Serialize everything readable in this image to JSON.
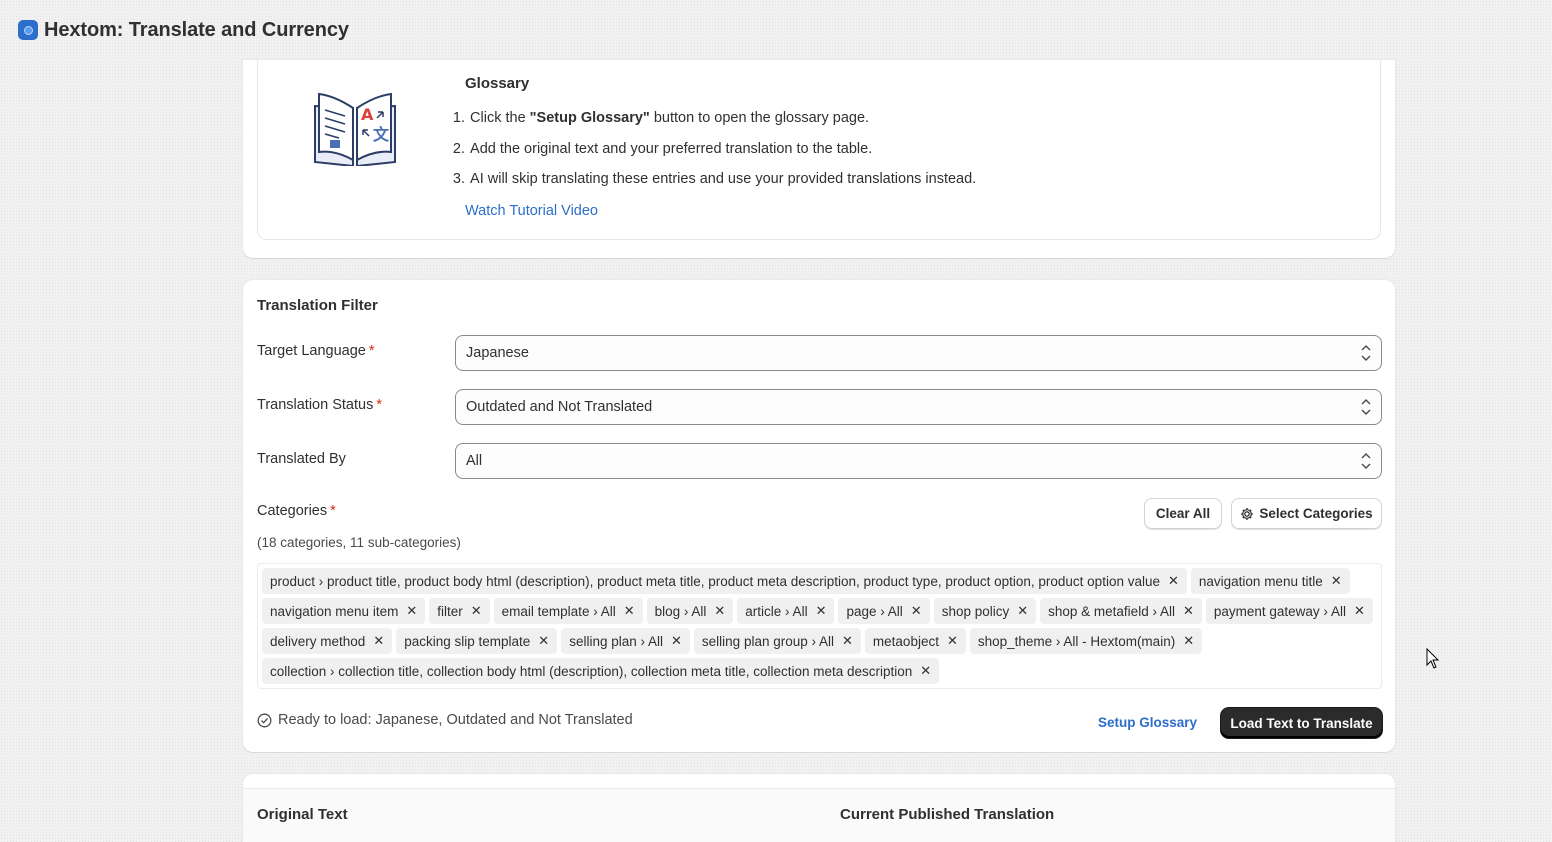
{
  "app": {
    "title": "Hextom: Translate and Currency"
  },
  "glossary": {
    "title": "Glossary",
    "steps": [
      {
        "num": "1.",
        "before": "Click the ",
        "bold": "\"Setup Glossary\"",
        "after": " button to open the glossary page."
      },
      {
        "num": "2.",
        "before": "Add the original text and your preferred translation to the table.",
        "bold": "",
        "after": ""
      },
      {
        "num": "3.",
        "before": "AI will skip translating these entries and use your provided translations instead.",
        "bold": "",
        "after": ""
      }
    ],
    "link": "Watch Tutorial Video"
  },
  "filter": {
    "title": "Translation Filter",
    "target_language": {
      "label": "Target Language",
      "required": "*",
      "value": "Japanese"
    },
    "translation_status": {
      "label": "Translation Status",
      "required": "*",
      "value": "Outdated and Not Translated"
    },
    "translated_by": {
      "label": "Translated By",
      "value": "All"
    },
    "categories": {
      "label": "Categories",
      "required": "*",
      "summary": "(18 categories, 11 sub-categories)",
      "clear_all": "Clear All",
      "select": "Select Categories",
      "tags": [
        "product › product title, product body html (description), product meta title, product meta description, product type, product option, product option value",
        "navigation menu title",
        "navigation menu item",
        "filter",
        "email template › All",
        "blog › All",
        "article › All",
        "page › All",
        "shop policy",
        "shop & metafield › All",
        "payment gateway › All",
        "delivery method",
        "packing slip template",
        "selling plan › All",
        "selling plan group › All",
        "metaobject",
        "shop_theme › All - Hextom(main)",
        "collection › collection title, collection body html (description), collection meta title, collection meta description"
      ]
    },
    "ready_text": "Ready to load: Japanese, Outdated and Not Translated",
    "setup_glossary": "Setup Glossary",
    "load_button": "Load Text to Translate"
  },
  "table": {
    "col_original": "Original Text",
    "col_current": "Current Published Translation"
  },
  "colors": {
    "accent": "#2c6ecb",
    "primary_button": "#2b2b2b",
    "required": "#d72c0d"
  }
}
